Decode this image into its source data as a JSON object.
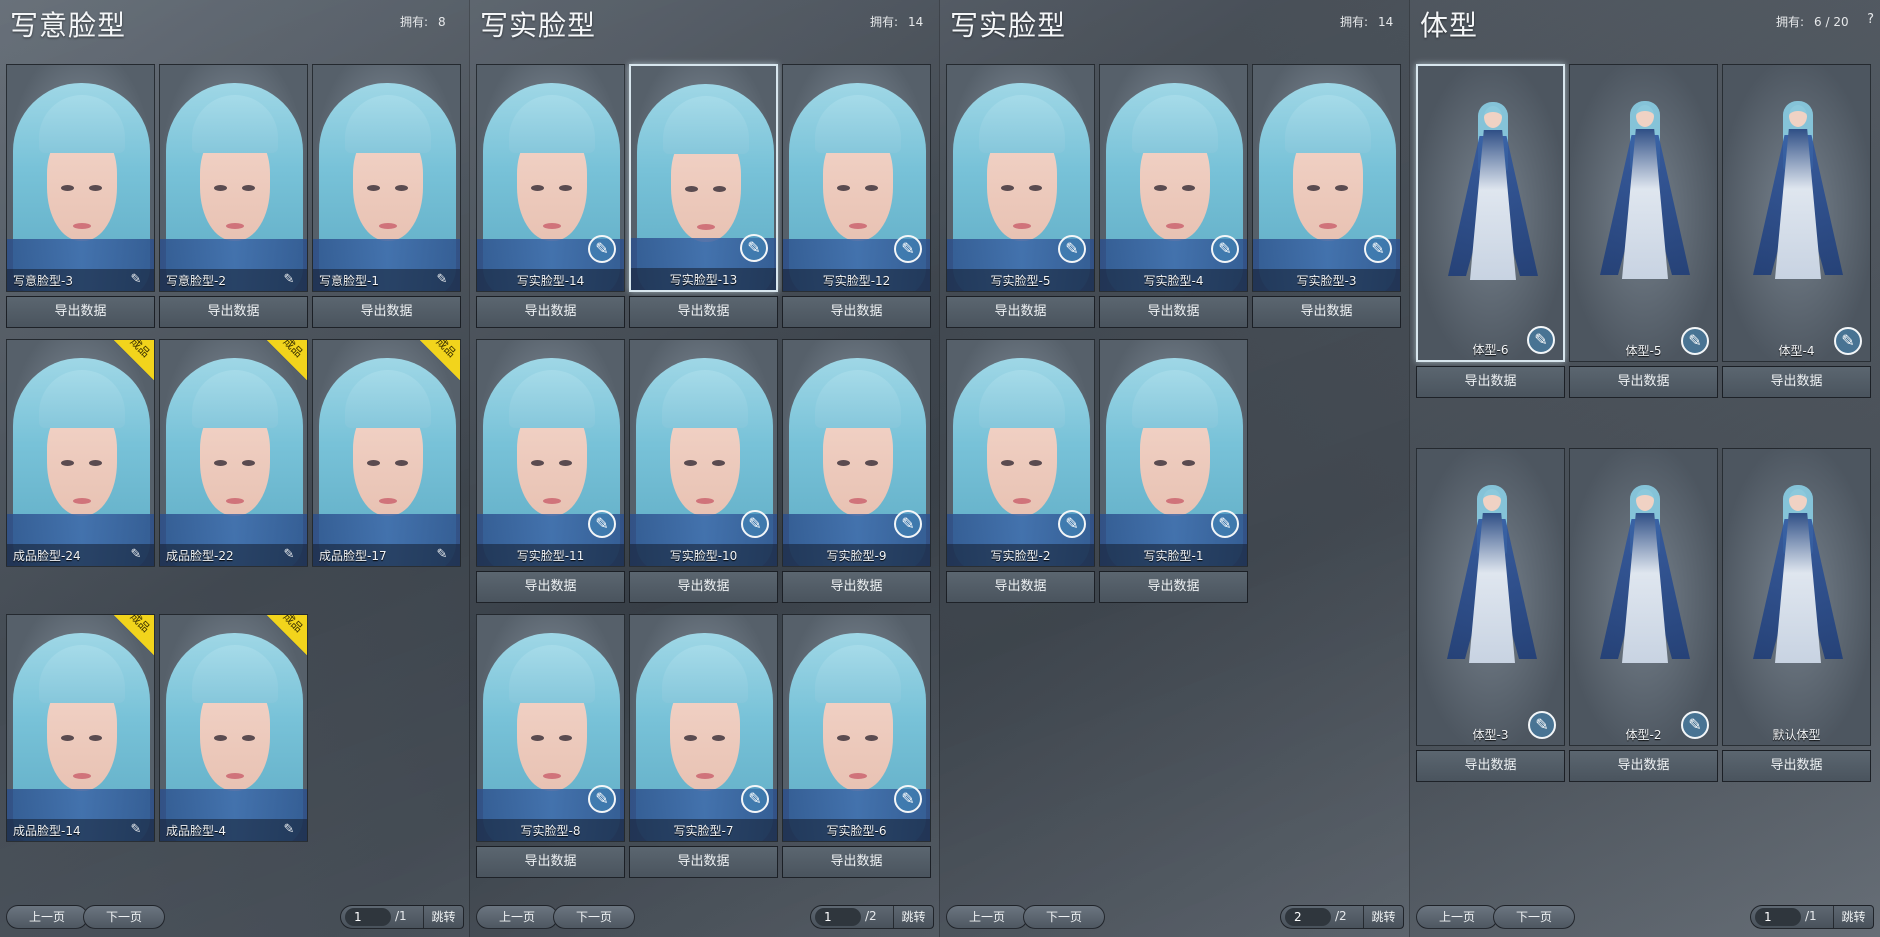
{
  "panels": [
    {
      "title": "写意脸型",
      "owned_label": "拥有:",
      "owned_value": "8",
      "pager": {
        "prev": "上一页",
        "next": "下一页",
        "page": "1",
        "total": "/1",
        "jump": "跳转"
      },
      "cards": [
        {
          "label": "写意脸型-3",
          "badge": ""
        },
        {
          "label": "写意脸型-2",
          "badge": ""
        },
        {
          "label": "写意脸型-1",
          "badge": ""
        },
        {
          "label": "成品脸型-24",
          "badge": "成品"
        },
        {
          "label": "成品脸型-22",
          "badge": "成品"
        },
        {
          "label": "成品脸型-17",
          "badge": "成品"
        },
        {
          "label": "成品脸型-14",
          "badge": "成品"
        },
        {
          "label": "成品脸型-4",
          "badge": "成品"
        }
      ]
    },
    {
      "title": "写实脸型",
      "owned_label": "拥有:",
      "owned_value": "14",
      "pager": {
        "prev": "上一页",
        "next": "下一页",
        "page": "1",
        "total": "/2",
        "jump": "跳转"
      },
      "cards": [
        {
          "label": "写实脸型-14"
        },
        {
          "label": "写实脸型-13",
          "selected": true
        },
        {
          "label": "写实脸型-12"
        },
        {
          "label": "写实脸型-11"
        },
        {
          "label": "写实脸型-10"
        },
        {
          "label": "写实脸型-9"
        },
        {
          "label": "写实脸型-8"
        },
        {
          "label": "写实脸型-7"
        },
        {
          "label": "写实脸型-6"
        }
      ]
    },
    {
      "title": "写实脸型",
      "owned_label": "拥有:",
      "owned_value": "14",
      "pager": {
        "prev": "上一页",
        "next": "下一页",
        "page": "2",
        "total": "/2",
        "jump": "跳转"
      },
      "cards": [
        {
          "label": "写实脸型-5"
        },
        {
          "label": "写实脸型-4"
        },
        {
          "label": "写实脸型-3"
        },
        {
          "label": "写实脸型-2"
        },
        {
          "label": "写实脸型-1"
        }
      ]
    },
    {
      "title": "体型",
      "owned_label": "拥有:",
      "owned_value": "6 / 20",
      "help": "?",
      "pager": {
        "prev": "上一页",
        "next": "下一页",
        "page": "1",
        "total": "/1",
        "jump": "跳转"
      },
      "cards": [
        {
          "label": "体型-6",
          "selected": true
        },
        {
          "label": "体型-5"
        },
        {
          "label": "体型-4"
        },
        {
          "label": "体型-3"
        },
        {
          "label": "体型-2"
        },
        {
          "label": "默认体型"
        }
      ]
    }
  ],
  "export_label": "导出数据",
  "edit_icon_glyph": "✎",
  "icons": {
    "edit": "edit-brush-icon",
    "help": "help-icon"
  },
  "colors": {
    "badge": "#f2d41c",
    "hair": "#8cc9dc",
    "robe": "#2f4f86"
  }
}
